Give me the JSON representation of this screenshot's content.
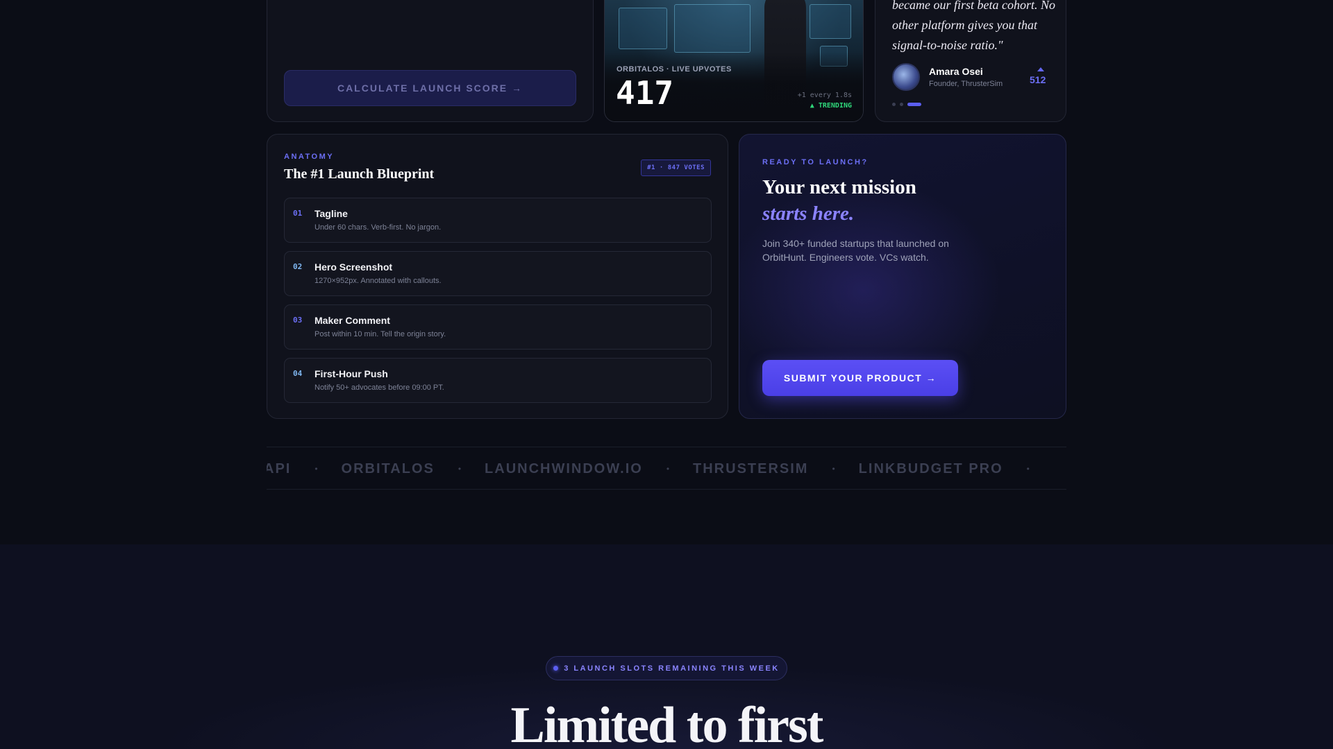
{
  "calculator": {
    "button_label": "CALCULATE LAUNCH SCORE →"
  },
  "upvotes": {
    "label": "ORBITALOS · LIVE UPVOTES",
    "count": "417",
    "rate": "+1 every 1.8s",
    "trend": "▲ TRENDING",
    "trend_color": "#2fd77a"
  },
  "testimonial": {
    "quote": "became our first beta cohort. No other platform gives you that signal-to-noise ratio.\"",
    "author": "Amara Osei",
    "role": "Founder, ThrusterSim",
    "votes": "512",
    "upvote_icon": "triangle-up-icon"
  },
  "blueprint": {
    "eyebrow": "ANATOMY",
    "title": "The #1 Launch Blueprint",
    "badge": "#1 · 847 VOTES",
    "items": [
      {
        "num": "01",
        "name": "Tagline",
        "desc": "Under 60 chars. Verb-first. No jargon.",
        "num_color": "#6c6ff5"
      },
      {
        "num": "02",
        "name": "Hero Screenshot",
        "desc": "1270×952px. Annotated with callouts.",
        "num_color": "#7fb6f0"
      },
      {
        "num": "03",
        "name": "Maker Comment",
        "desc": "Post within 10 min. Tell the origin story.",
        "num_color": "#6c6ff5"
      },
      {
        "num": "04",
        "name": "First-Hour Push",
        "desc": "Notify 50+ advocates before 09:00 PT.",
        "num_color": "#7fb6f0"
      }
    ]
  },
  "cta": {
    "eyebrow": "READY TO LAUNCH?",
    "headline_1": "Your next mission",
    "headline_2": "starts here.",
    "description": "Join 340+ funded startups that launched on OrbitHunt. Engineers vote. VCs watch.",
    "button_label": "SUBMIT YOUR PRODUCT →",
    "accent": "#5b4ff5"
  },
  "marquee": {
    "items": [
      "API",
      "ORBITALOS",
      "LAUNCHWINDOW.IO",
      "THRUSTERSIM",
      "LINKBUDGET PRO"
    ],
    "separator": "•"
  },
  "scarcity": {
    "pill_text": "3 LAUNCH SLOTS REMAINING THIS WEEK",
    "headline": "Limited to first"
  }
}
